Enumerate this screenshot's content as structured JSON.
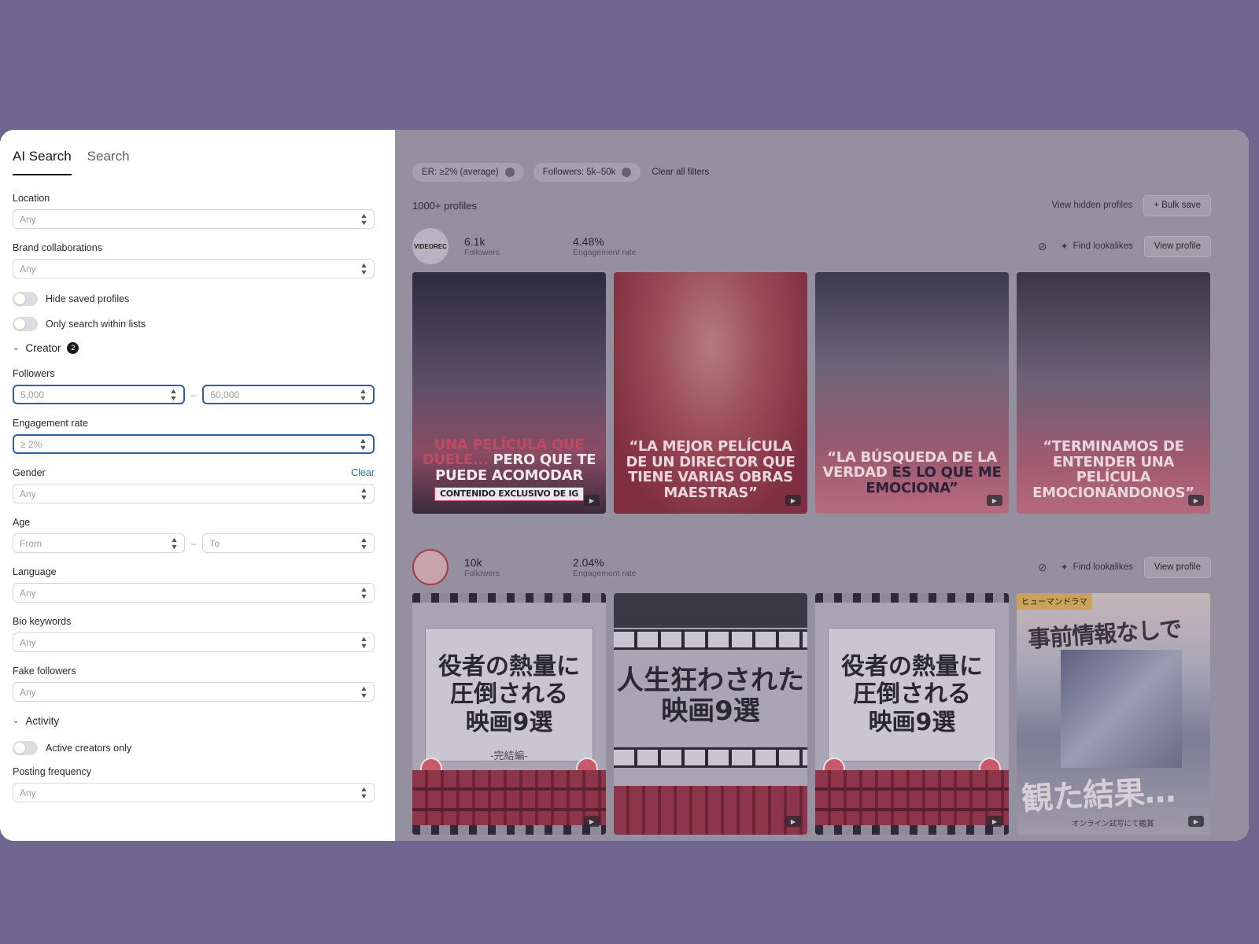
{
  "tabs": [
    "AI Search",
    "Search"
  ],
  "filters": {
    "location": {
      "label": "Location",
      "placeholder": "Any"
    },
    "brand_collaborations": {
      "label": "Brand collaborations",
      "placeholder": "Any"
    },
    "hide_saved": "Hide saved profiles",
    "only_lists": "Only search within lists",
    "creator_section": {
      "label": "Creator",
      "badge": "2"
    },
    "followers": {
      "label": "Followers",
      "from": "5,000",
      "to": "50,000",
      "dash": "–"
    },
    "engagement_rate": {
      "label": "Engagement rate",
      "value": "≥ 2%"
    },
    "gender": {
      "label": "Gender",
      "clear": "Clear",
      "placeholder": "Any"
    },
    "age": {
      "label": "Age",
      "from": "From",
      "to": "To",
      "dash": "–"
    },
    "language": {
      "label": "Language",
      "placeholder": "Any"
    },
    "bio_keywords": {
      "label": "Bio keywords",
      "placeholder": "Any"
    },
    "fake_followers": {
      "label": "Fake followers",
      "placeholder": "Any"
    },
    "activity_section": {
      "label": "Activity"
    },
    "active_only": "Active creators only",
    "posting_frequency": {
      "label": "Posting frequency",
      "placeholder": "Any"
    }
  },
  "chips": [
    "ER: ≥2% (average)",
    "Followers: 5k–50k"
  ],
  "clear_all": "Clear all filters",
  "results": {
    "count": "1000+ profiles",
    "view_hidden": "View hidden profiles",
    "bulk_save": "+ Bulk save"
  },
  "profiles": [
    {
      "avatar_text": "VIDEOREC",
      "followers": "6.1k",
      "followers_label": "Followers",
      "er": "4.48%",
      "er_label": "Engagement rate",
      "find_lookalikes": "Find lookalikes",
      "view_profile": "View profile",
      "posts": [
        {
          "caption_top": "UNA PELÍCULA QUE",
          "caption_mid_a": "DUELE...",
          "caption_mid_b": "PERO QUE TE",
          "caption_bottom": "PUEDE ACOMODAR",
          "strip": "CONTENIDO EXCLUSIVO DE IG"
        },
        {
          "caption": "“LA MEJOR PELÍCULA DE UN DIRECTOR QUE TIENE VARIAS OBRAS MAESTRAS”"
        },
        {
          "caption_a": "“LA BÚSQUEDA DE LA VERDAD",
          "caption_b": "ES LO QUE ME EMOCIONA”"
        },
        {
          "caption": "“TERMINAMOS DE ENTENDER UNA PELÍCULA EMOCIONÁNDONOS”"
        }
      ]
    },
    {
      "followers": "10k",
      "followers_label": "Followers",
      "er": "2.04%",
      "er_label": "Engagement rate",
      "find_lookalikes": "Find lookalikes",
      "view_profile": "View profile",
      "posts": [
        {
          "title_l1": "役者の熱量に",
          "title_l2": "圧倒される",
          "title_l3": "映画9選",
          "sub": "-完結編-"
        },
        {
          "title_l1": "人生狂わされた",
          "title_l2": "映画9選"
        },
        {
          "title_l1": "役者の熱量に",
          "title_l2": "圧倒される",
          "title_l3": "映画9選"
        },
        {
          "tag": "ヒューマンドラマ",
          "headline": "事前情報なしで",
          "bottom": "観た結果…",
          "small": "オンライン試写にて鑑賞"
        }
      ]
    }
  ]
}
